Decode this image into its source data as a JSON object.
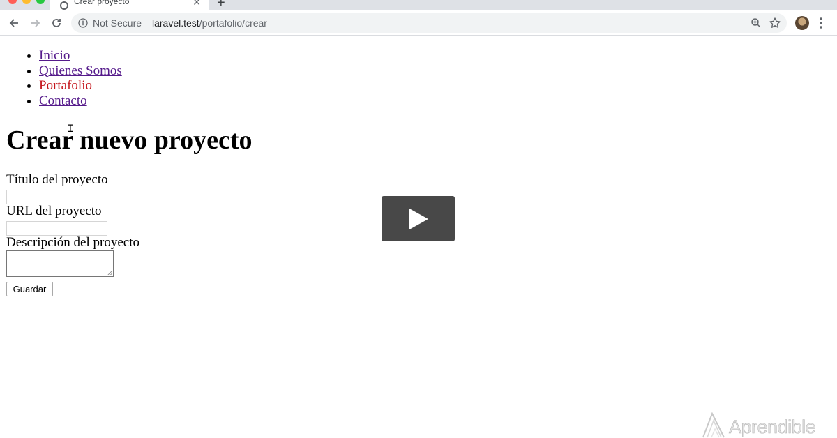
{
  "browser": {
    "tab": {
      "title": "Crear proyecto",
      "close": "✕"
    },
    "new_tab": "+",
    "security_label": "Not Secure",
    "url": {
      "host": "laravel.test",
      "path": "/portafolio/crear"
    }
  },
  "nav": {
    "items": [
      {
        "label": "Inicio",
        "active": false
      },
      {
        "label": "Quienes Somos",
        "active": false
      },
      {
        "label": "Portafolio",
        "active": true
      },
      {
        "label": "Contacto",
        "active": false
      }
    ]
  },
  "form": {
    "title": "Crear nuevo proyecto",
    "fields": [
      {
        "label": "Título del proyecto",
        "value": ""
      },
      {
        "label": "URL del proyecto",
        "value": ""
      },
      {
        "label": "Descripción del proyecto",
        "value": ""
      }
    ],
    "submit_label": "Guardar"
  },
  "watermark": {
    "text": "Aprendible"
  },
  "colors": {
    "link_visited": "#551a8b",
    "link_active": "#c4161c",
    "play_overlay": "#282828"
  }
}
